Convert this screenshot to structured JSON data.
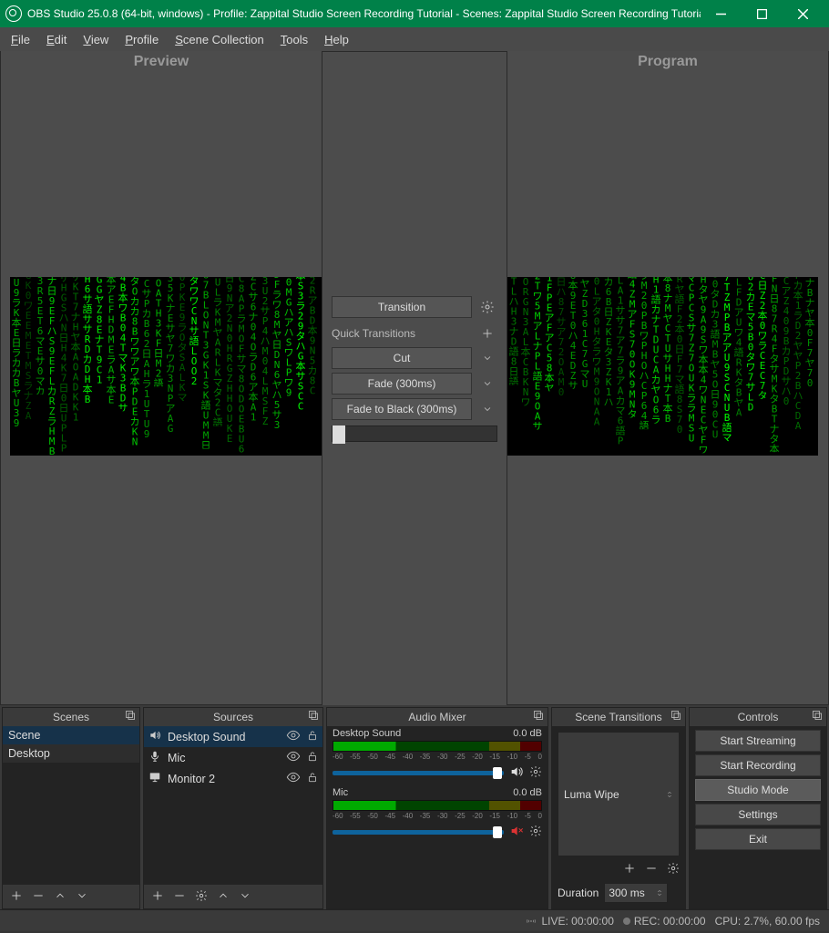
{
  "titlebar": "OBS Studio 25.0.8 (64-bit, windows) - Profile: Zappital Studio Screen Recording Tutorial - Scenes: Zappital Studio Screen Recording Tutorial",
  "menu": [
    "File",
    "Edit",
    "View",
    "Profile",
    "Scene Collection",
    "Tools",
    "Help"
  ],
  "panes": {
    "preview": "Preview",
    "program": "Program"
  },
  "transitions": {
    "main_button": "Transition",
    "quick_label": "Quick Transitions",
    "quick": [
      "Cut",
      "Fade (300ms)",
      "Fade to Black (300ms)"
    ]
  },
  "docks": {
    "scenes": {
      "title": "Scenes",
      "items": [
        "Scene",
        "Desktop"
      ],
      "selected": 0
    },
    "sources": {
      "title": "Sources",
      "items": [
        {
          "icon": "speaker",
          "name": "Desktop Sound"
        },
        {
          "icon": "mic",
          "name": "Mic"
        },
        {
          "icon": "monitor",
          "name": "Monitor 2"
        }
      ],
      "selected": 0
    },
    "audio": {
      "title": "Audio Mixer",
      "channels": [
        {
          "name": "Desktop Sound",
          "db": "0.0 dB",
          "muted": false
        },
        {
          "name": "Mic",
          "db": "0.0 dB",
          "muted": true
        }
      ],
      "ticks": [
        "-60",
        "-55",
        "-50",
        "-45",
        "-40",
        "-35",
        "-30",
        "-25",
        "-20",
        "-15",
        "-10",
        "-5",
        "0"
      ]
    },
    "scene_trans": {
      "title": "Scene Transitions",
      "selected": "Luma Wipe",
      "duration_label": "Duration",
      "duration_value": "300 ms"
    },
    "controls": {
      "title": "Controls",
      "buttons": [
        "Start Streaming",
        "Start Recording",
        "Studio Mode",
        "Settings",
        "Exit"
      ],
      "active": 2
    }
  },
  "status": {
    "live": "LIVE: 00:00:00",
    "rec": "REC: 00:00:00",
    "cpu": "CPU: 2.7%, 60.00 fps"
  }
}
